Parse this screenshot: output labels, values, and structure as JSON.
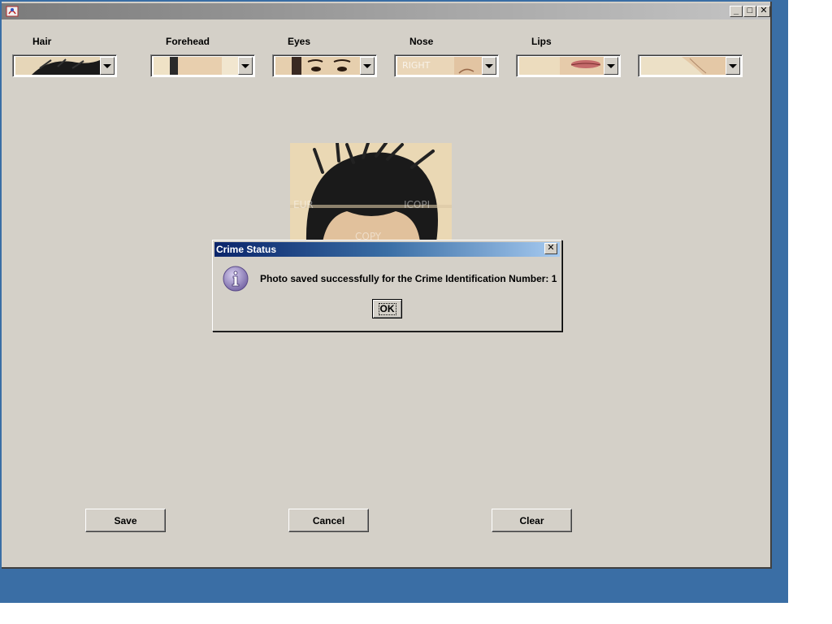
{
  "window": {
    "title": ""
  },
  "features": [
    {
      "label": "Hair",
      "icon": "hair-thumbnail"
    },
    {
      "label": "Forehead",
      "icon": "forehead-thumbnail"
    },
    {
      "label": "Eyes",
      "icon": "eyes-thumbnail"
    },
    {
      "label": "Nose",
      "icon": "nose-thumbnail"
    },
    {
      "label": "Lips",
      "icon": "lips-thumbnail"
    },
    {
      "label": "",
      "icon": "chin-thumbnail"
    }
  ],
  "buttons": {
    "save": "Save",
    "cancel": "Cancel",
    "clear": "Clear"
  },
  "dialog": {
    "title": "Crime Status",
    "message": "Photo saved successfully for the Crime Identification Number: 1",
    "ok": "OK",
    "icon": "information-icon"
  },
  "colors": {
    "desktop": "#3a6ea5",
    "window_bg": "#d4d0c8",
    "dialog_title_start": "#0a246a",
    "dialog_title_end": "#a6caf0"
  }
}
